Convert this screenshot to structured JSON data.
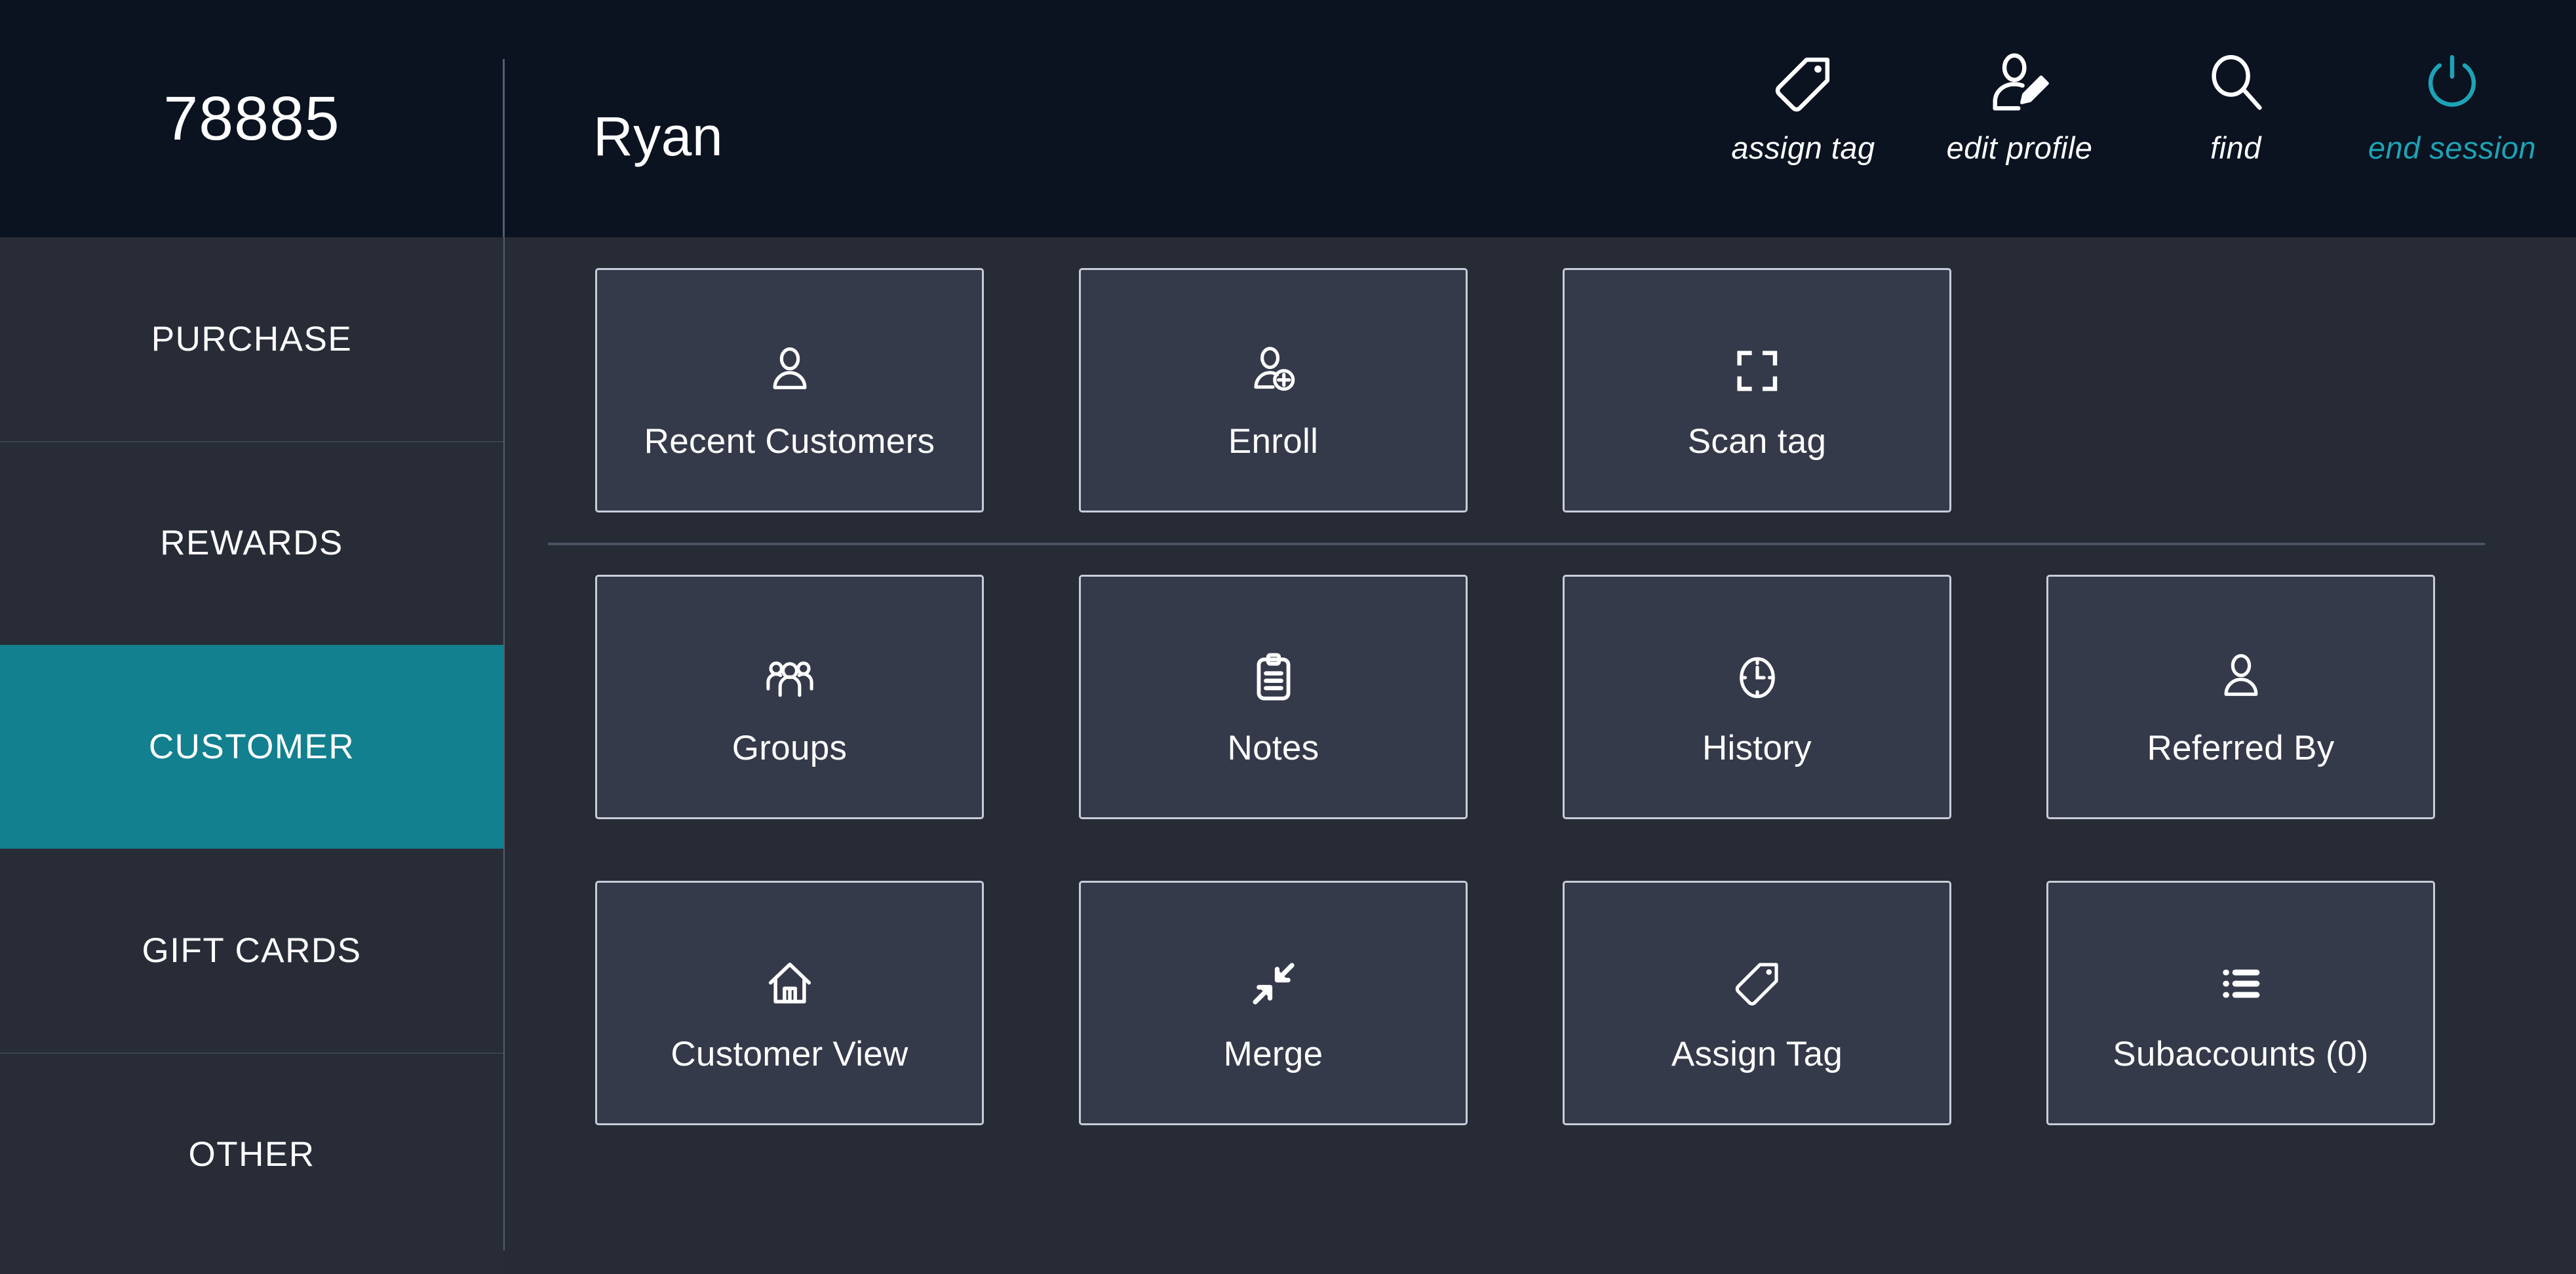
{
  "header": {
    "account_number": "78885",
    "customer_name": "Ryan",
    "actions": [
      {
        "label": "assign tag",
        "icon": "tag-icon",
        "accent": false
      },
      {
        "label": "edit profile",
        "icon": "user-edit-icon",
        "accent": false
      },
      {
        "label": "find",
        "icon": "search-icon",
        "accent": false
      },
      {
        "label": "end session",
        "icon": "power-icon",
        "accent": true
      }
    ]
  },
  "sidebar": {
    "items": [
      {
        "label": "PURCHASE",
        "active": false
      },
      {
        "label": "REWARDS",
        "active": false
      },
      {
        "label": "CUSTOMER",
        "active": true
      },
      {
        "label": "GIFT CARDS",
        "active": false
      },
      {
        "label": "OTHER",
        "active": false
      }
    ]
  },
  "main": {
    "row1": [
      {
        "label": "Recent Customers",
        "icon": "person-icon"
      },
      {
        "label": "Enroll",
        "icon": "person-add-icon"
      },
      {
        "label": "Scan tag",
        "icon": "scan-frame-icon"
      }
    ],
    "row2": [
      {
        "label": "Groups",
        "icon": "people-group-icon"
      },
      {
        "label": "Notes",
        "icon": "clipboard-icon"
      },
      {
        "label": "History",
        "icon": "clock-icon"
      },
      {
        "label": "Referred By",
        "icon": "person-icon"
      }
    ],
    "row3": [
      {
        "label": "Customer View",
        "icon": "home-icon"
      },
      {
        "label": "Merge",
        "icon": "merge-arrows-icon"
      },
      {
        "label": "Assign Tag",
        "icon": "tag-icon"
      },
      {
        "label": "Subaccounts (0)",
        "icon": "list-icon"
      }
    ]
  },
  "colors": {
    "header_bg": "#0b1220",
    "sidebar_bg": "#272c37",
    "main_bg": "#262b36",
    "tile_bg": "#353a4a",
    "tile_border": "#c9cdd9",
    "accent_teal": "#12808f",
    "accent_cyan": "#1da3b5",
    "text": "#ffffff"
  }
}
